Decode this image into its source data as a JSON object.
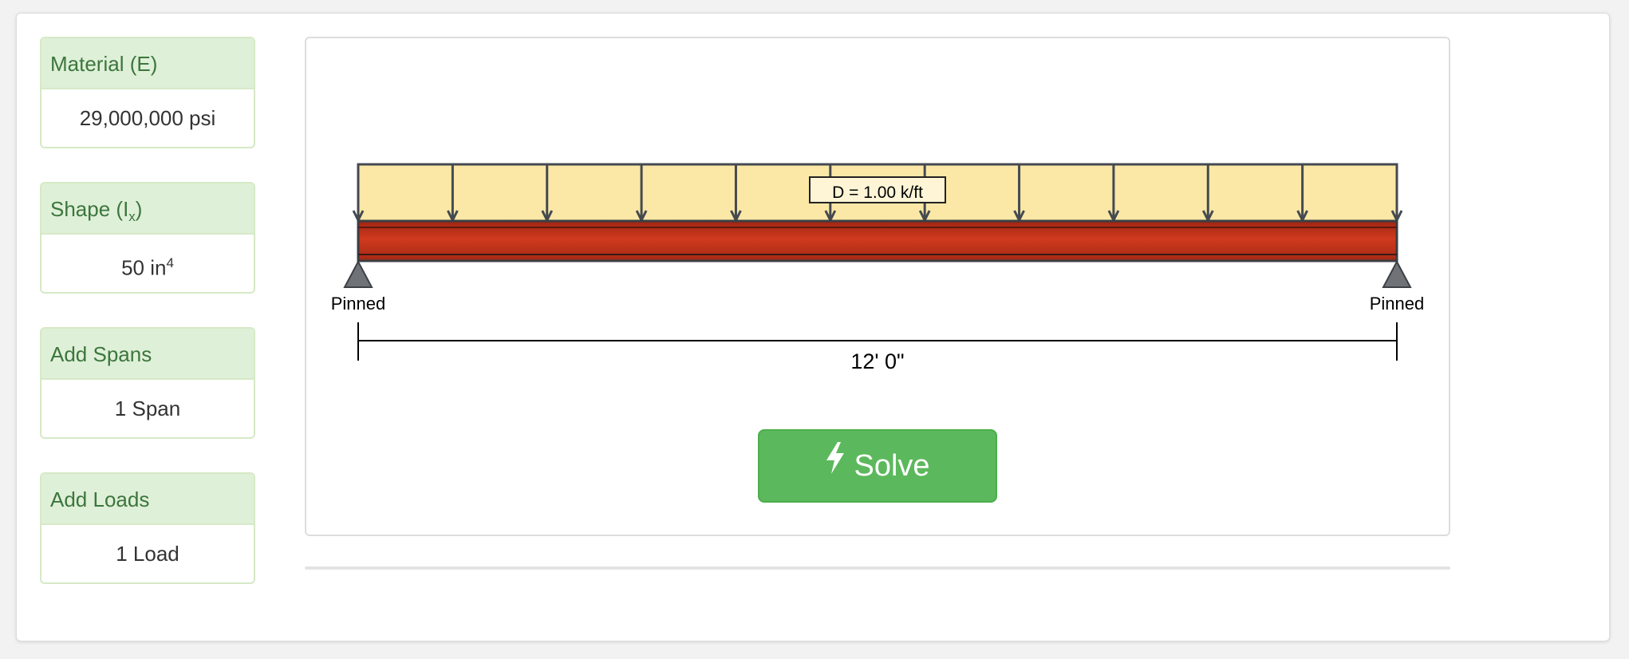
{
  "panels": {
    "material": {
      "heading": "Material (E)",
      "value": "29,000,000 psi"
    },
    "shape": {
      "heading_text": "Shape (I",
      "heading_sub": "x",
      "heading_close": ")",
      "value_text": "50 in",
      "value_sup": "4"
    },
    "spans": {
      "heading": "Add Spans",
      "value": "1 Span"
    },
    "loads": {
      "heading": "Add Loads",
      "value": "1 Load"
    }
  },
  "beam": {
    "load_label": "D = 1.00 k/ft",
    "left_support": "Pinned",
    "right_support": "Pinned",
    "span_length": "12' 0\"",
    "load_arrow_count": 12
  },
  "solve": {
    "label": "Solve",
    "icon": "bolt-icon"
  },
  "colors": {
    "panel_heading_bg": "#dff0d8",
    "panel_heading_text": "#3c763d",
    "panel_border": "#d6e9c6",
    "beam_red": "#c0301a",
    "load_fill": "#fbe8a6",
    "solve_green": "#5cb85c"
  }
}
